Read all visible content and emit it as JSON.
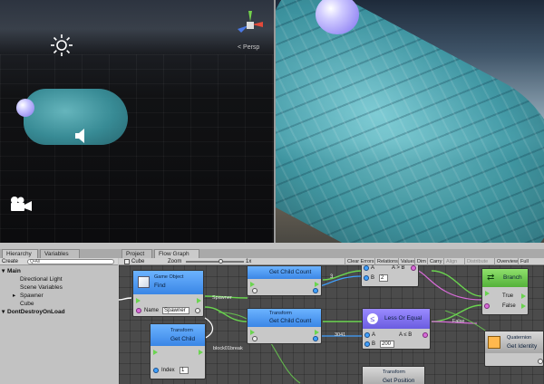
{
  "colors": {
    "accent": "#3a86e6",
    "flow_green": "#6ad44f",
    "pink_wire": "#d86bd8",
    "blue_wire": "#3fa0ff"
  },
  "scene": {
    "persp_label": "< Persp",
    "icons": [
      "sun-icon",
      "speaker-icon",
      "camera-icon",
      "axis-gizmo-icon"
    ]
  },
  "hierarchy": {
    "tabs": [
      "Hierarchy",
      "Variables"
    ],
    "create_label": "Create",
    "search_placeholder": "Q•All",
    "items": [
      {
        "label": "Main",
        "bold": true,
        "indent": 0
      },
      {
        "label": "Directional Light",
        "bold": false,
        "indent": 1
      },
      {
        "label": "Scene Variables",
        "bold": false,
        "indent": 1
      },
      {
        "label": "Spawner",
        "bold": false,
        "indent": 1
      },
      {
        "label": "Cube",
        "bold": false,
        "indent": 1
      },
      {
        "label": "DontDestroyOnLoad",
        "bold": true,
        "indent": 0
      }
    ]
  },
  "flow_graph": {
    "tabs": [
      "Project",
      "Flow Graph"
    ],
    "object_label": "Cube",
    "zoom_label": "Zoom",
    "zoom_value": "1x",
    "toolbar": [
      "Clear Errors",
      "Relations",
      "Values",
      "Dim",
      "Carry",
      "Align",
      "Distribute",
      "Overview",
      "Full Screen"
    ],
    "nodes": {
      "find": {
        "title_top": "Game Object",
        "title": "Find",
        "name_label": "Name",
        "name_value": "Spawner"
      },
      "get_child_count_1": {
        "title": "Get Child Count"
      },
      "compare": {
        "a_label": "A",
        "b_label": "B",
        "b_value": "2",
        "op": "A > B"
      },
      "branch": {
        "title": "Branch",
        "true_label": "True",
        "false_label": "False"
      },
      "get_child_count_2": {
        "title_top": "Transform",
        "title": "Get Child Count"
      },
      "get_child": {
        "title_top": "Transform",
        "title": "Get Child",
        "index_label": "Index",
        "index_value": "1"
      },
      "less_or_equal": {
        "title": "Less Or Equal",
        "a_label": "A",
        "b_label": "B",
        "b_value": "200",
        "op": "A ≤ B"
      },
      "quaternion": {
        "title_top": "Quaternion",
        "title": "Get Identity"
      },
      "get_position": {
        "title_top": "Transform",
        "title": "Get Position"
      }
    },
    "wire_labels": {
      "spawner": "Spawner",
      "block": "block01break",
      "false": "False",
      "count": "3",
      "value": "3041"
    }
  }
}
